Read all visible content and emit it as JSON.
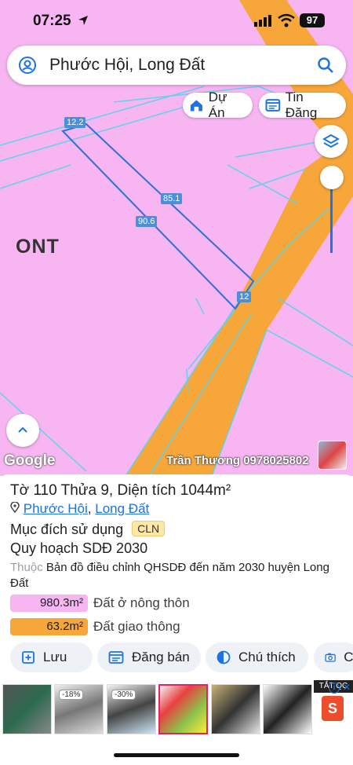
{
  "status_bar": {
    "time": "07:25",
    "battery": "97"
  },
  "search": {
    "query": "Phước Hội, Long Đất"
  },
  "chips": {
    "du_an": "Dự Án",
    "tin_dang": "Tin Đăng"
  },
  "map": {
    "zone_label": "ONT",
    "dimensions": {
      "top": "12.2",
      "right": "85.1",
      "left": "90.6",
      "bottom": "12"
    },
    "google_logo": "Google",
    "watermark": "Trần Thương 0978025802",
    "colors": {
      "residential": "#f7b5f2",
      "road": "#f7a63a",
      "boundary": "#5fd3e8"
    }
  },
  "parcel": {
    "title_prefix": "Tờ",
    "sheet": "110",
    "plot_prefix": "Thửa",
    "plot": "9,",
    "area_prefix": "Diện tích",
    "area": "1044m²",
    "ward": "Phước Hội",
    "district": "Long Đất",
    "purpose_label": "Mục đích sử dụng",
    "purpose_code": "CLN",
    "plan_label": "Quy hoạch SDĐ 2030",
    "source_prefix": "Thuộc",
    "source_text": "Bản đồ điều chỉnh QHSDĐ đến năm 2030 huyện Long Đất",
    "legend": [
      {
        "value": "980.3m²",
        "label": "Đất ở nông thôn",
        "color": "#f7b5f2"
      },
      {
        "value": "63.2m²",
        "label": "Đất giao thông",
        "color": "#f7a63a"
      }
    ]
  },
  "actions": {
    "save": "Lưu",
    "sell": "Đăng bán",
    "legend": "Chú thích",
    "capture": "Ch"
  },
  "ads": {
    "tag": "TẮT QC",
    "discount_1": "-18%",
    "discount_2": "-30%"
  }
}
